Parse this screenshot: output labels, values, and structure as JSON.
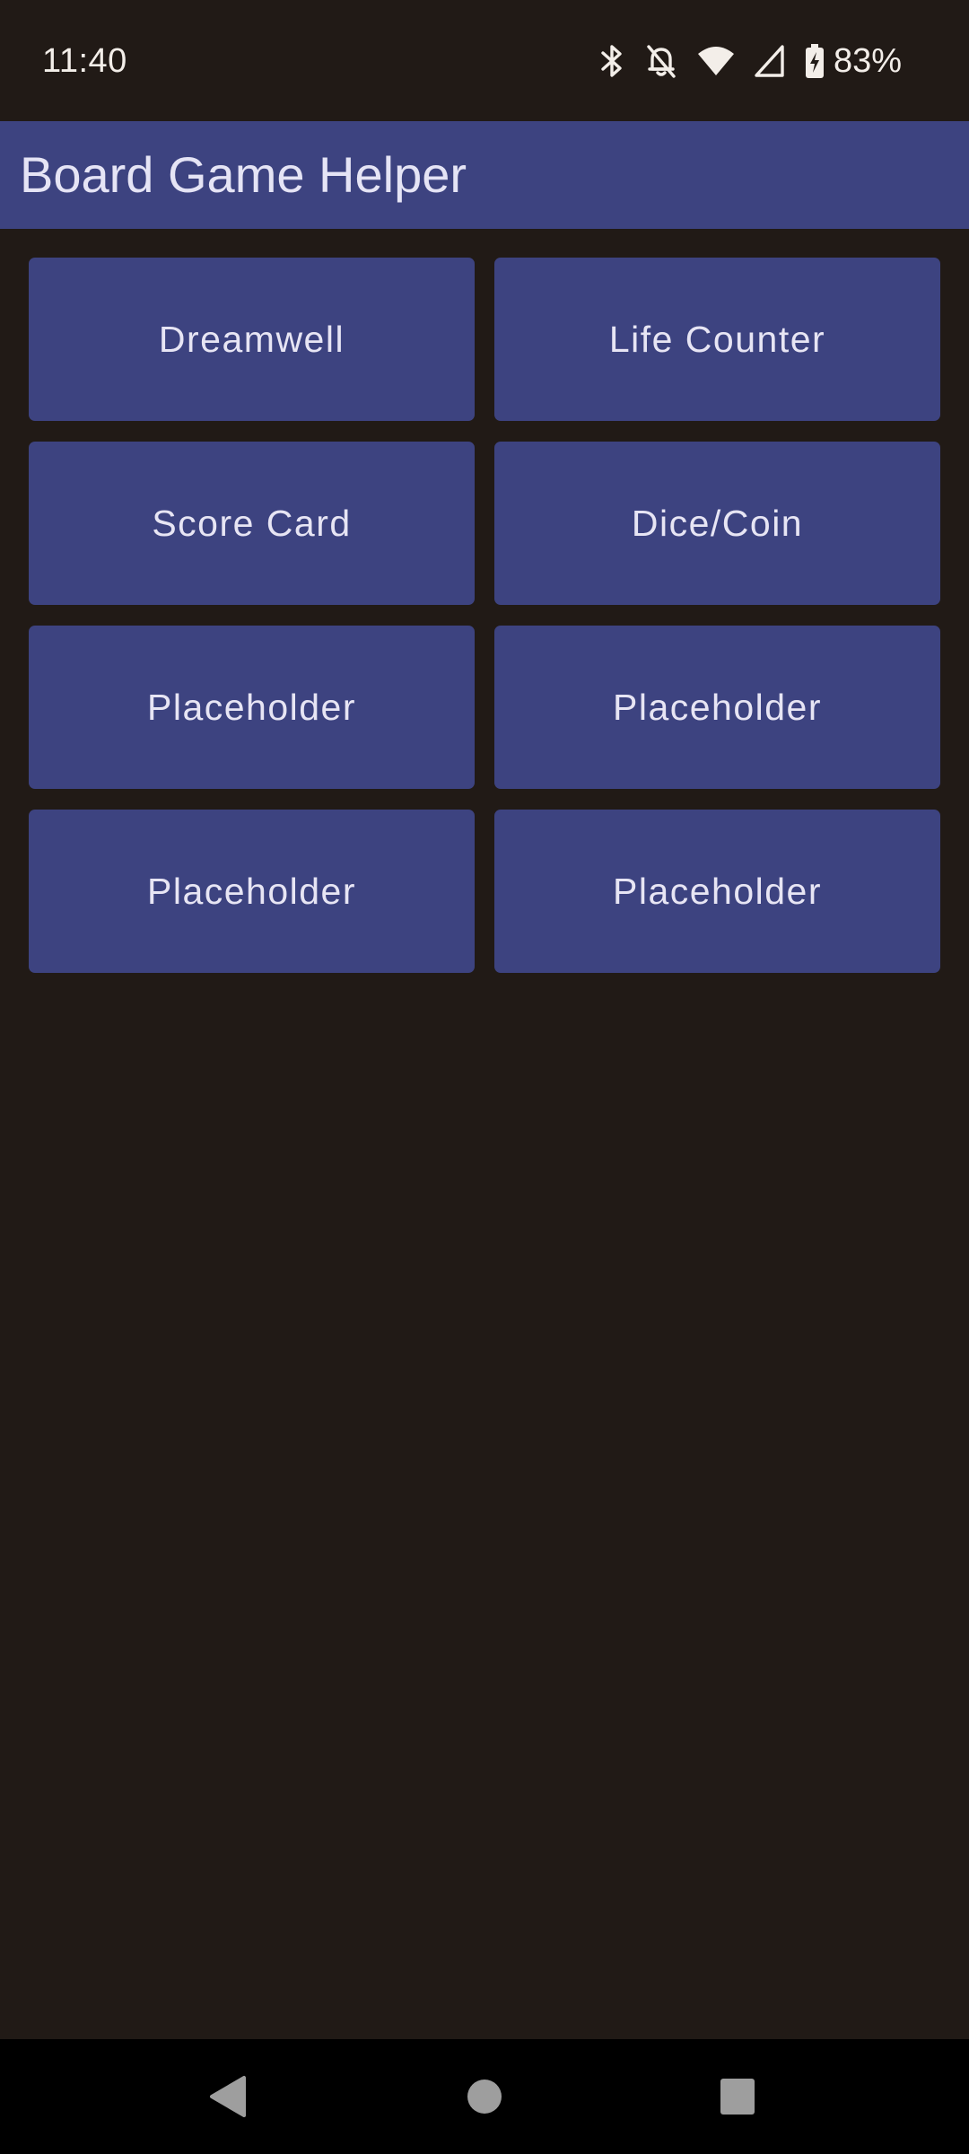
{
  "status_bar": {
    "time": "11:40",
    "battery_percent": "83%",
    "icons": [
      "bluetooth-icon",
      "notifications-off-icon",
      "wifi-icon",
      "cell-signal-icon",
      "battery-charging-icon"
    ]
  },
  "app_bar": {
    "title": "Board Game Helper"
  },
  "tiles": [
    {
      "label": "Dreamwell"
    },
    {
      "label": "Life Counter"
    },
    {
      "label": "Score Card"
    },
    {
      "label": "Dice/Coin"
    },
    {
      "label": "Placeholder"
    },
    {
      "label": "Placeholder"
    },
    {
      "label": "Placeholder"
    },
    {
      "label": "Placeholder"
    }
  ],
  "nav_bar": {
    "icons": [
      "back-icon",
      "home-icon",
      "recents-icon"
    ]
  },
  "colors": {
    "background": "#211a16",
    "primary": "#3d4380",
    "on_primary": "#e7e5f4",
    "nav_bar": "#000000"
  }
}
